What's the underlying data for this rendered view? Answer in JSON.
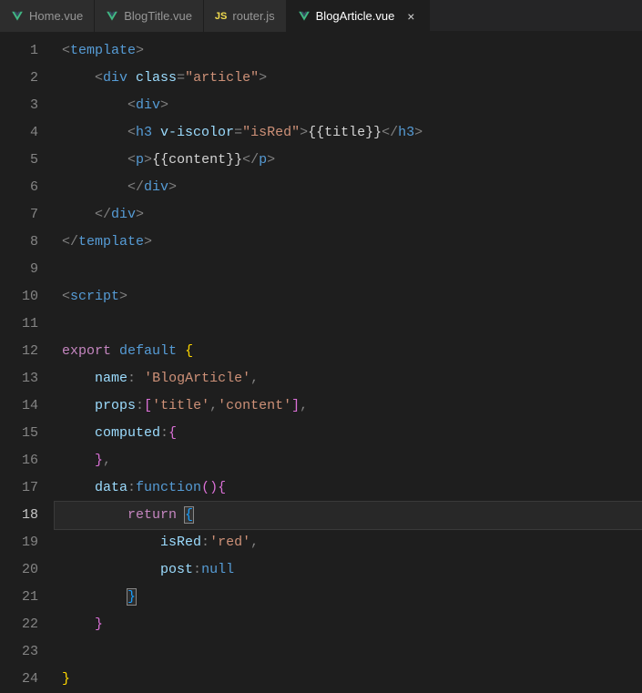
{
  "tabs": [
    {
      "label": "Home.vue",
      "icon": "vue",
      "active": false
    },
    {
      "label": "BlogTitle.vue",
      "icon": "vue",
      "active": false
    },
    {
      "label": "router.js",
      "icon": "js",
      "active": false
    },
    {
      "label": "BlogArticle.vue",
      "icon": "vue",
      "active": true
    }
  ],
  "currentLine": 18,
  "code": {
    "l1": {
      "indent": 0,
      "tokens": [
        [
          "punct",
          "<"
        ],
        [
          "tag",
          "template"
        ],
        [
          "punct",
          ">"
        ]
      ]
    },
    "l2": {
      "indent": 1,
      "tokens": [
        [
          "punct",
          "<"
        ],
        [
          "tag",
          "div"
        ],
        [
          "",
          ""
        ],
        [
          "attr",
          " class"
        ],
        [
          "punct",
          "="
        ],
        [
          "string",
          "\"article\""
        ],
        [
          "punct",
          ">"
        ]
      ]
    },
    "l3": {
      "indent": 2,
      "tokens": [
        [
          "punct",
          "<"
        ],
        [
          "tag",
          "div"
        ],
        [
          "punct",
          ">"
        ]
      ]
    },
    "l4": {
      "indent": 2,
      "tokens": [
        [
          "punct",
          "<"
        ],
        [
          "tag",
          "h3"
        ],
        [
          "attr",
          " v-iscolor"
        ],
        [
          "punct",
          "="
        ],
        [
          "string",
          "\"isRed\""
        ],
        [
          "punct",
          ">"
        ],
        [
          "mustache",
          "{{title}}"
        ],
        [
          "punct",
          "</"
        ],
        [
          "tag",
          "h3"
        ],
        [
          "punct",
          ">"
        ]
      ]
    },
    "l5": {
      "indent": 2,
      "tokens": [
        [
          "punct",
          "<"
        ],
        [
          "tag",
          "p"
        ],
        [
          "punct",
          ">"
        ],
        [
          "mustache",
          "{{content}}"
        ],
        [
          "punct",
          "</"
        ],
        [
          "tag",
          "p"
        ],
        [
          "punct",
          ">"
        ]
      ]
    },
    "l6": {
      "indent": 2,
      "tokens": [
        [
          "punct",
          "</"
        ],
        [
          "tag",
          "div"
        ],
        [
          "punct",
          ">"
        ]
      ]
    },
    "l7": {
      "indent": 1,
      "tokens": [
        [
          "punct",
          "</"
        ],
        [
          "tag",
          "div"
        ],
        [
          "punct",
          ">"
        ]
      ]
    },
    "l8": {
      "indent": 0,
      "tokens": [
        [
          "punct",
          "</"
        ],
        [
          "tag",
          "template"
        ],
        [
          "punct",
          ">"
        ]
      ]
    },
    "l9": {
      "indent": 0,
      "tokens": []
    },
    "l10": {
      "indent": 0,
      "tokens": [
        [
          "punct",
          "<"
        ],
        [
          "tag",
          "script"
        ],
        [
          "punct",
          ">"
        ]
      ]
    },
    "l11": {
      "indent": 0,
      "tokens": []
    },
    "l12": {
      "indent": 0,
      "tokens": [
        [
          "keyword-export",
          "export"
        ],
        [
          "",
          " "
        ],
        [
          "keyword-default",
          "default"
        ],
        [
          "",
          " "
        ],
        [
          "brace-y",
          "{"
        ]
      ]
    },
    "l13": {
      "indent": 1,
      "tokens": [
        [
          "prop",
          "name"
        ],
        [
          "punct",
          ":"
        ],
        [
          "",
          " "
        ],
        [
          "string",
          "'BlogArticle'"
        ],
        [
          "punct",
          ","
        ]
      ]
    },
    "l14": {
      "indent": 1,
      "tokens": [
        [
          "prop",
          "props"
        ],
        [
          "punct",
          ":"
        ],
        [
          "brace-p",
          "["
        ],
        [
          "string",
          "'title'"
        ],
        [
          "punct",
          ","
        ],
        [
          "string",
          "'content'"
        ],
        [
          "brace-p",
          "]"
        ],
        [
          "punct",
          ","
        ]
      ]
    },
    "l15": {
      "indent": 1,
      "tokens": [
        [
          "prop",
          "computed"
        ],
        [
          "punct",
          ":"
        ],
        [
          "brace-p",
          "{"
        ]
      ]
    },
    "l16": {
      "indent": 1,
      "tokens": [
        [
          "brace-p",
          "}"
        ],
        [
          "punct",
          ","
        ]
      ]
    },
    "l17": {
      "indent": 1,
      "tokens": [
        [
          "prop",
          "data"
        ],
        [
          "punct",
          ":"
        ],
        [
          "keyword-function",
          "function"
        ],
        [
          "brace-p",
          "("
        ],
        [
          "brace-p",
          ")"
        ],
        [
          "brace-p",
          "{"
        ]
      ]
    },
    "l18": {
      "indent": 2,
      "tokens": [
        [
          "keyword-return",
          "return"
        ],
        [
          "",
          " "
        ],
        [
          "brace-b bracket-match",
          "{"
        ]
      ]
    },
    "l19": {
      "indent": 3,
      "tokens": [
        [
          "prop",
          "isRed"
        ],
        [
          "punct",
          ":"
        ],
        [
          "string",
          "'red'"
        ],
        [
          "punct",
          ","
        ]
      ]
    },
    "l20": {
      "indent": 3,
      "tokens": [
        [
          "prop",
          "post"
        ],
        [
          "punct",
          ":"
        ],
        [
          "keyword-null",
          "null"
        ]
      ]
    },
    "l21": {
      "indent": 2,
      "tokens": [
        [
          "brace-b bracket-match",
          "}"
        ]
      ]
    },
    "l22": {
      "indent": 1,
      "tokens": [
        [
          "brace-p",
          "}"
        ]
      ]
    },
    "l23": {
      "indent": 0,
      "tokens": []
    },
    "l24": {
      "indent": 0,
      "tokens": [
        [
          "brace-y",
          "}"
        ]
      ]
    }
  }
}
